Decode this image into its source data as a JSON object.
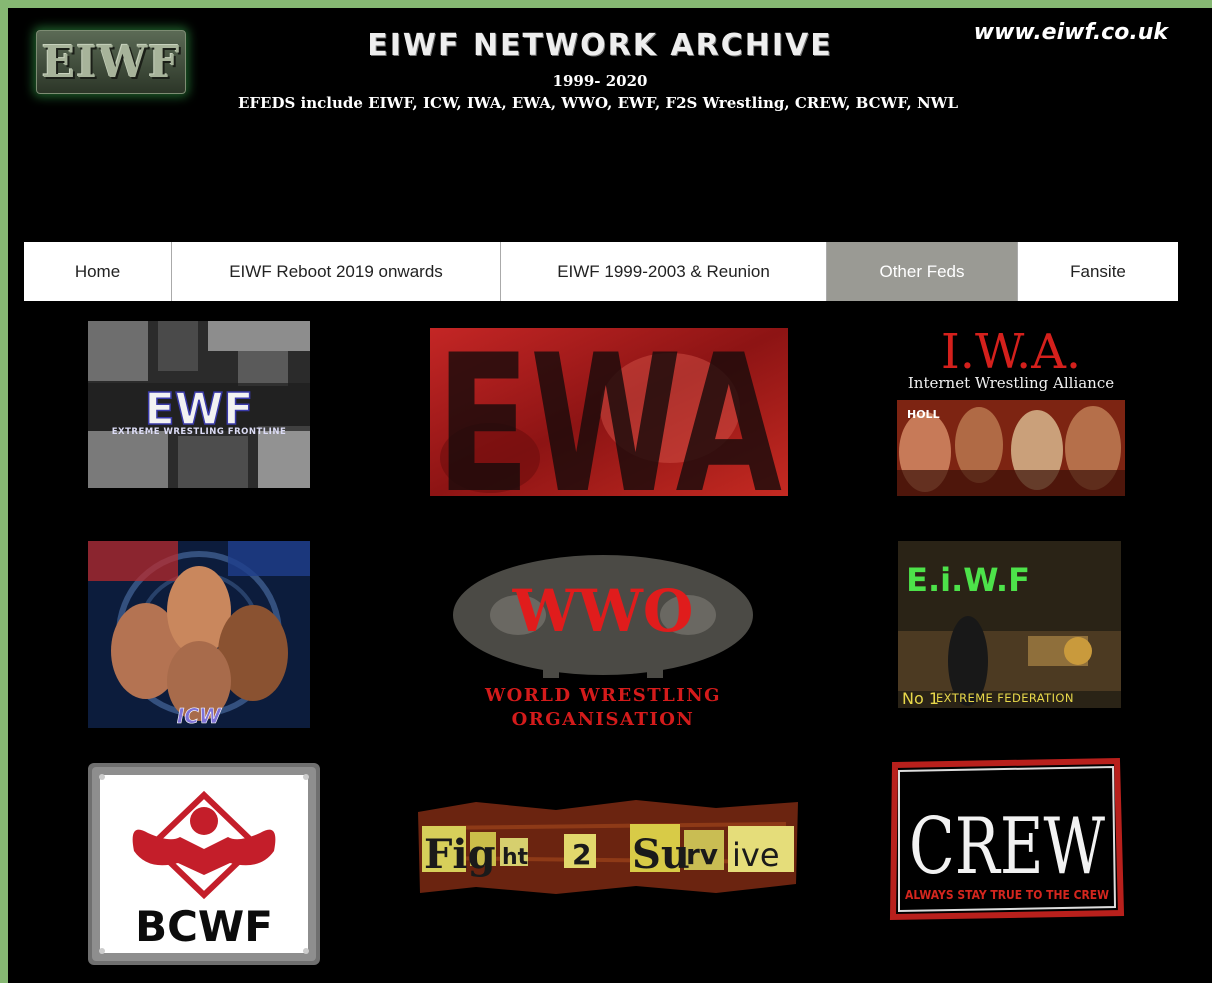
{
  "header": {
    "logo_text": "EIWF",
    "title": "EIWF NETWORK ARCHIVE",
    "years": "1999- 2020",
    "efeds": "EFEDS include EIWF, ICW, IWA, EWA, WWO, EWF, F2S Wrestling, CREW, BCWF, NWL",
    "url": "www.eiwf.co.uk"
  },
  "nav": {
    "items": [
      {
        "label": "Home"
      },
      {
        "label": "EIWF Reboot 2019 onwards"
      },
      {
        "label": "EIWF 1999-2003 & Reunion"
      },
      {
        "label": "Other Feds",
        "active": true
      },
      {
        "label": "Fansite"
      }
    ]
  },
  "feds": {
    "ewf": {
      "logo": "EWF",
      "tagline": "EXTREME WRESTLING FRONTLINE"
    },
    "ewa": {
      "logo": "EWA"
    },
    "iwa": {
      "logo": "I.W.A.",
      "tagline": "Internet Wrestling Alliance",
      "poster_text": "HOLL"
    },
    "icw": {
      "logo": "ICW"
    },
    "wwo": {
      "logo": "WWO",
      "line1": "WORLD WRESTLING",
      "line2": "ORGANISATION"
    },
    "eiwf": {
      "logo": "E.i.W.F",
      "footer_a": "No 1",
      "footer_b": "EXTREME FEDERATION"
    },
    "bcwf": {
      "logo": "BCWF"
    },
    "f2s": {
      "logo_parts": [
        "Fig",
        "ht",
        "2",
        "Su",
        "rv",
        "ive"
      ]
    },
    "crew": {
      "logo": "CREW",
      "tagline": "ALWAYS STAY TRUE TO THE CREW"
    }
  },
  "colors": {
    "page_border": "#86b873",
    "nav_active": "#9a9a94",
    "ewa_red": "#b8191a",
    "wwo_red": "#e01c1c",
    "eiwf_green": "#4de24a"
  }
}
